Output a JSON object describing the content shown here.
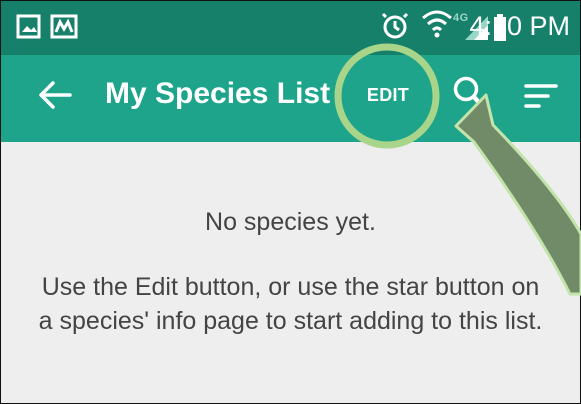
{
  "status_bar": {
    "time": "4:10 PM",
    "network_label": "4G",
    "icons": [
      "gallery-icon",
      "photo-icon",
      "alarm-icon",
      "wifi-icon",
      "signal-icon",
      "battery-icon"
    ]
  },
  "app_bar": {
    "title": "My Species List",
    "edit_label": "EDIT",
    "icons": [
      "back-arrow-icon",
      "search-icon",
      "sort-icon"
    ]
  },
  "content": {
    "empty_title": "No species yet.",
    "empty_message": "Use the Edit button, or use the star button on a species' info page to start adding to this list."
  },
  "colors": {
    "status_bar": "#17806b",
    "app_bar": "#1ea48b",
    "background": "#eeeeee",
    "annotation": "#a8d58a",
    "arrow_fill": "#718a68"
  }
}
